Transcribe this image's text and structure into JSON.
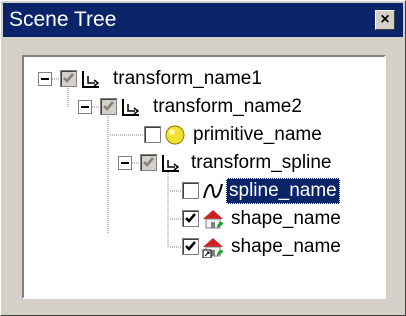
{
  "window": {
    "title": "Scene Tree",
    "close_label": "×"
  },
  "tree": {
    "nodes": [
      {
        "label": "transform_name1",
        "icon": "transform-icon",
        "checked": "grey"
      },
      {
        "label": "transform_name2",
        "icon": "transform-icon",
        "checked": "grey"
      },
      {
        "label": "primitive_name",
        "icon": "sphere-icon",
        "checked": "no"
      },
      {
        "label": "transform_spline",
        "icon": "transform-icon",
        "checked": "grey"
      },
      {
        "label": "spline_name",
        "icon": "spline-icon",
        "checked": "no",
        "selected": true
      },
      {
        "label": "shape_name",
        "icon": "house-icon",
        "checked": "yes"
      },
      {
        "label": "shape_name",
        "icon": "house-link-icon",
        "checked": "yes"
      }
    ]
  },
  "colors": {
    "titlebar": "#0a246a",
    "selection": "#0a246a",
    "sphere": "#f2e030",
    "house_roof": "#d02020",
    "house_leaf": "#20a030"
  }
}
